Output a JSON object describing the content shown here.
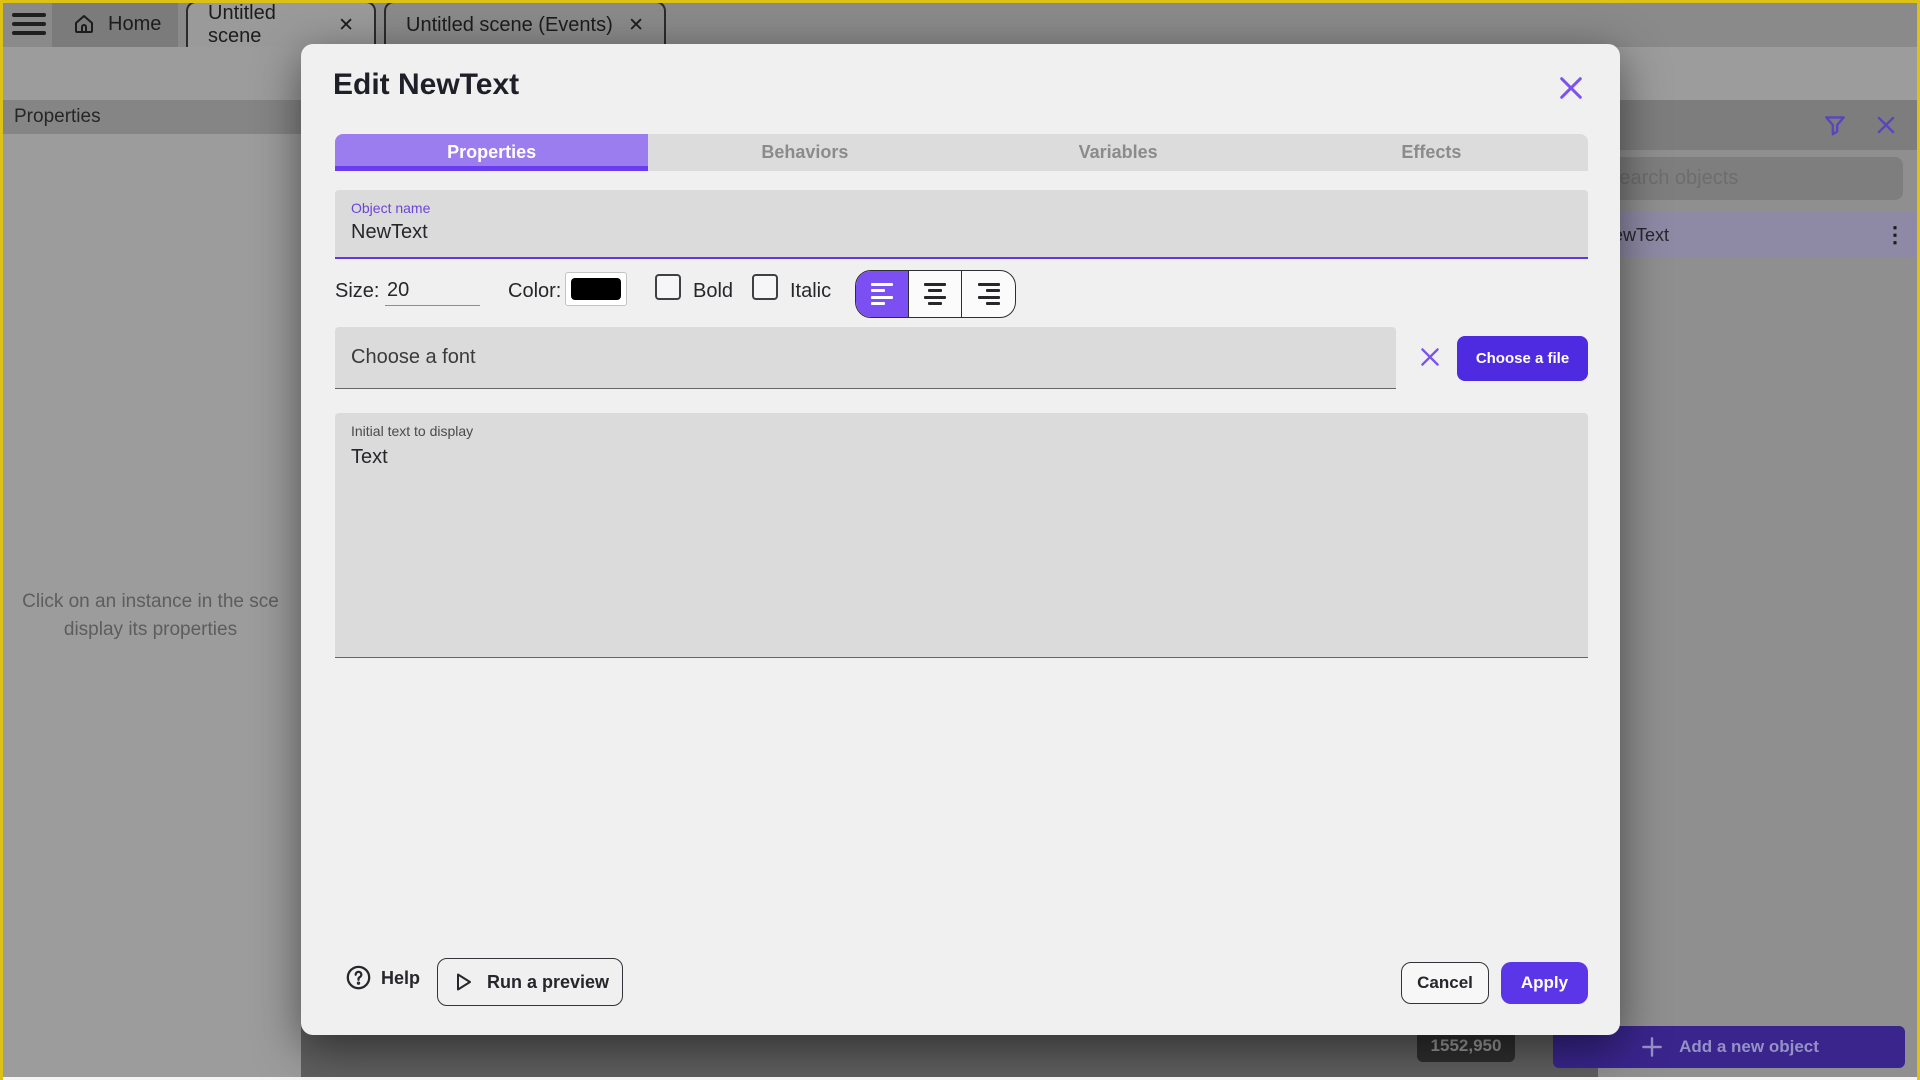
{
  "topbar": {
    "tabs": [
      {
        "label": "Home"
      },
      {
        "label": "Untitled scene"
      },
      {
        "label": "Untitled scene (Events)"
      }
    ]
  },
  "left_panel": {
    "header": "Properties",
    "message_line1": "Click on an instance in the sce",
    "message_line2": "display its properties"
  },
  "right_panel": {
    "search_placeholder": "Search objects",
    "selected_object": "NewText",
    "add_button_label": "Add a new object",
    "kebab": "⋮"
  },
  "canvas": {
    "coordinates_badge": "1552,950"
  },
  "dialog": {
    "title": "Edit NewText",
    "tabs": [
      {
        "label": "Properties"
      },
      {
        "label": "Behaviors"
      },
      {
        "label": "Variables"
      },
      {
        "label": "Effects"
      }
    ],
    "fields": {
      "object_name": {
        "label": "Object name",
        "value": "NewText"
      },
      "size": {
        "label": "Size:",
        "value": "20"
      },
      "color_label": "Color:",
      "color_value": "#000000",
      "bold_label": "Bold",
      "italic_label": "Italic",
      "font_placeholder": "Choose a font",
      "choose_file_label": "Choose a file",
      "initial_text": {
        "label": "Initial text to display",
        "value": "Text"
      }
    },
    "footer": {
      "help_label": "Help",
      "run_preview_label": "Run a preview",
      "cancel_label": "Cancel",
      "apply_label": "Apply"
    }
  }
}
